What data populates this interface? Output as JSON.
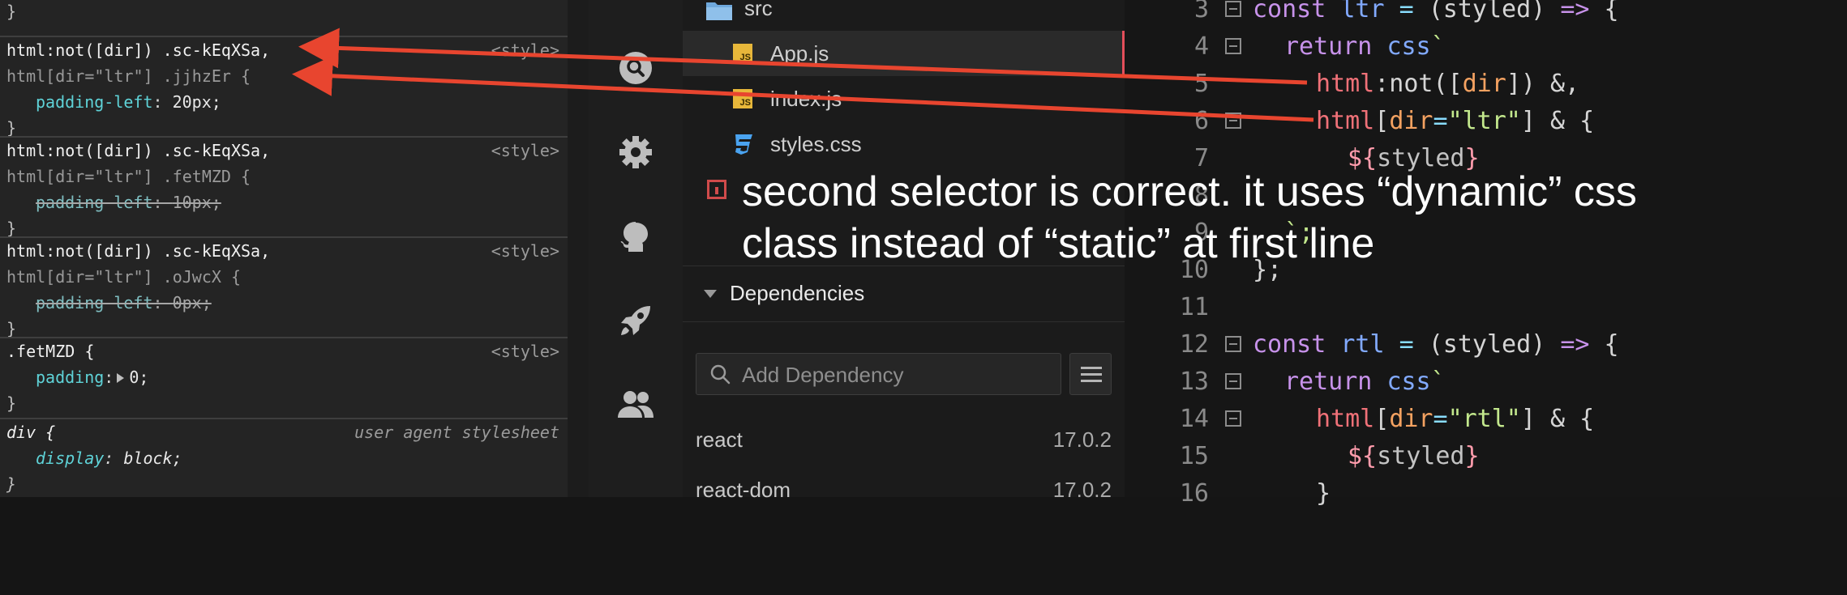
{
  "devtools": {
    "rules": [
      {
        "closing_only": true
      },
      {
        "selector_match": "html:not([dir]) .sc-kEqXSa,",
        "selector_rest": "html[dir=\"ltr\"] .jjhzEr {",
        "origin": "<style>",
        "property": "padding-left",
        "value": "20px;",
        "struck": false
      },
      {
        "selector_match": "html:not([dir]) .sc-kEqXSa,",
        "selector_rest": "html[dir=\"ltr\"] .fetMZD {",
        "origin": "<style>",
        "property": "padding-left",
        "value": "10px;",
        "struck": true
      },
      {
        "selector_match": "html:not([dir]) .sc-kEqXSa,",
        "selector_rest": "html[dir=\"ltr\"] .oJwcX {",
        "origin": "<style>",
        "property": "padding-left",
        "value": "0px;",
        "struck": true
      },
      {
        "selector_match": ".fetMZD {",
        "origin": "<style>",
        "property": "padding",
        "value": "0;",
        "struck": false
      },
      {
        "selector_match": "div {",
        "origin": "user agent stylesheet",
        "property": "display",
        "value": "block;",
        "struck": false
      }
    ],
    "closing_brace": "}"
  },
  "activity_bar": {
    "icons": [
      "search-icon",
      "gear-icon",
      "github-icon",
      "rocket-icon",
      "users-icon"
    ]
  },
  "explorer": {
    "files": [
      {
        "name": "src",
        "icon": "folder-icon"
      },
      {
        "name": "App.js",
        "icon": "js-file-icon",
        "active": true
      },
      {
        "name": "index.js",
        "icon": "js-file-icon"
      },
      {
        "name": "styles.css",
        "icon": "css-file-icon"
      }
    ],
    "js_badge": "JS",
    "dependencies": {
      "title": "Dependencies",
      "search_placeholder": "Add Dependency",
      "items": [
        {
          "name": "react",
          "version": "17.0.2"
        },
        {
          "name": "react-dom",
          "version": "17.0.2"
        }
      ]
    }
  },
  "editor": {
    "lines": [
      {
        "n": "3",
        "fold": true
      },
      {
        "n": "4",
        "fold": true
      },
      {
        "n": "5",
        "fold": false
      },
      {
        "n": "6",
        "fold": true
      },
      {
        "n": "7",
        "fold": false
      },
      {
        "n": "8",
        "fold": false
      },
      {
        "n": "9",
        "fold": false
      },
      {
        "n": "10",
        "fold": false
      },
      {
        "n": "11",
        "fold": false
      },
      {
        "n": "12",
        "fold": true
      },
      {
        "n": "13",
        "fold": true
      },
      {
        "n": "14",
        "fold": true
      },
      {
        "n": "15",
        "fold": false
      },
      {
        "n": "16",
        "fold": false
      }
    ],
    "tokens": {
      "l3": [
        "const",
        "ltr",
        "=",
        "(styled)",
        "=>",
        "{"
      ],
      "l4": [
        "return",
        "css",
        "`"
      ],
      "l5": [
        "html",
        ":not([",
        "dir",
        "])",
        "&,"
      ],
      "l6": [
        "html",
        "[",
        "dir",
        "=",
        "\"ltr\"",
        "]",
        "&",
        "{"
      ],
      "l7": [
        "${",
        "styled",
        "}"
      ],
      "l9": "`;",
      "l10": "};",
      "l12": [
        "const",
        "rtl",
        "=",
        "(styled)",
        "=>",
        "{"
      ],
      "l13": [
        "return",
        "css",
        "`"
      ],
      "l14": [
        "html",
        "[",
        "dir",
        "=",
        "\"rtl\"",
        "]",
        "&",
        "{"
      ],
      "l15": [
        "${",
        "styled",
        "}"
      ],
      "l16": "}"
    }
  },
  "annotation": {
    "caption": "second selector is correct. it uses “dynamic” css class instead of “static” at first line",
    "arrow_color": "#e8452f"
  }
}
